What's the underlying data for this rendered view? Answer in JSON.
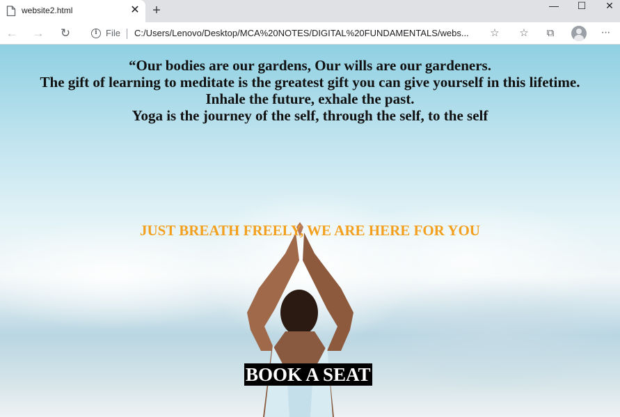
{
  "browser": {
    "tab_title": "website2.html",
    "tab_close": "✕",
    "new_tab": "+",
    "window_controls": {
      "minimize": "—",
      "maximize": "☐",
      "close": "✕"
    },
    "scheme_label": "File",
    "url": "C:/Users/Lenovo/Desktop/MCA%20NOTES/DIGITAL%20FUNDAMENTALS/webs...",
    "icons": [
      "back-icon",
      "forward-icon",
      "reload-icon",
      "info-icon",
      "add-favorite-icon",
      "favorites-icon",
      "collections-icon",
      "profile-icon",
      "more-icon"
    ]
  },
  "page": {
    "quote_lines": [
      "“Our bodies are our gardens, Our wills are our gardeners.",
      "The gift of learning to meditate is the greatest gift you can give yourself in this lifetime.",
      "Inhale the future, exhale the past.",
      "Yoga is the journey of the self, through the self, to the self"
    ],
    "tagline": "JUST BREATH FREELY, WE ARE HERE FOR YOU",
    "book_button": "BOOK A SEAT",
    "colors": {
      "tagline": "#f3a01f",
      "quote": "#111111",
      "button_bg": "#000000",
      "button_text": "#ffffff",
      "sky": "#8fd0e2"
    }
  }
}
